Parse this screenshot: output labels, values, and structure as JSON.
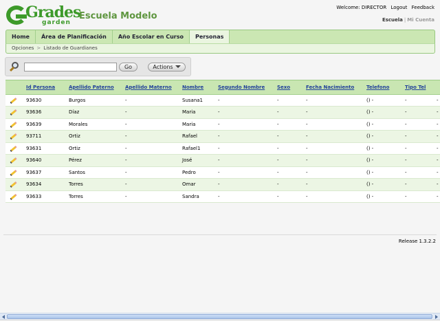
{
  "header": {
    "logo_text": "Grades",
    "logo_subtext": "garden",
    "school_name": "Escuela Modelo",
    "welcome": "Welcome: DIRECTOR",
    "logout": "Logout",
    "feedback": "Feedback",
    "context_active": "Escuela",
    "context_separator": "|",
    "context_inactive": "Mi Cuenta"
  },
  "nav": {
    "tabs": [
      {
        "label": "Home"
      },
      {
        "label": "Área de Planificación"
      },
      {
        "label": "Año Escolar en Curso"
      },
      {
        "label": "Personas"
      }
    ],
    "active_tab": "Personas"
  },
  "breadcrumb": {
    "root": "Opciones",
    "separator": ">",
    "current": "Listado de Guardianes"
  },
  "search": {
    "value": "",
    "go_label": "Go",
    "actions_label": "Actions"
  },
  "table": {
    "columns": [
      "Id Persona",
      "Apellido Paterno",
      "Apellido Materno",
      "Nombre",
      "Segundo Nombre",
      "Sexo",
      "Fecha Nacimiento",
      "Telefono",
      "Tipo Tel"
    ],
    "rows": [
      {
        "id": "93630",
        "ap_paterno": "Burgos",
        "ap_materno": "-",
        "nombre": "Susana1",
        "segundo": "-",
        "sexo": "-",
        "fecha": "-",
        "telefono": "() -",
        "tipo": "-",
        "extra": "-"
      },
      {
        "id": "93636",
        "ap_paterno": "Díaz",
        "ap_materno": "-",
        "nombre": "Maria",
        "segundo": "-",
        "sexo": "-",
        "fecha": "-",
        "telefono": "() -",
        "tipo": "-",
        "extra": "-"
      },
      {
        "id": "93639",
        "ap_paterno": "Morales",
        "ap_materno": "-",
        "nombre": "Maria",
        "segundo": "-",
        "sexo": "-",
        "fecha": "-",
        "telefono": "() -",
        "tipo": "-",
        "extra": "-"
      },
      {
        "id": "93711",
        "ap_paterno": "Ortiz",
        "ap_materno": "-",
        "nombre": "Rafael",
        "segundo": "-",
        "sexo": "-",
        "fecha": "-",
        "telefono": "() -",
        "tipo": "-",
        "extra": "-"
      },
      {
        "id": "93631",
        "ap_paterno": "Ortiz",
        "ap_materno": "-",
        "nombre": "Rafael1",
        "segundo": "-",
        "sexo": "-",
        "fecha": "-",
        "telefono": "() -",
        "tipo": "-",
        "extra": "-"
      },
      {
        "id": "93640",
        "ap_paterno": "Pérez",
        "ap_materno": "-",
        "nombre": "José",
        "segundo": "-",
        "sexo": "-",
        "fecha": "-",
        "telefono": "() -",
        "tipo": "-",
        "extra": "-"
      },
      {
        "id": "93637",
        "ap_paterno": "Santos",
        "ap_materno": "-",
        "nombre": "Pedro",
        "segundo": "-",
        "sexo": "-",
        "fecha": "-",
        "telefono": "() -",
        "tipo": "-",
        "extra": "-"
      },
      {
        "id": "93634",
        "ap_paterno": "Torres",
        "ap_materno": "-",
        "nombre": "Omar",
        "segundo": "-",
        "sexo": "-",
        "fecha": "-",
        "telefono": "() -",
        "tipo": "-",
        "extra": "-"
      },
      {
        "id": "93633",
        "ap_paterno": "Torres",
        "ap_materno": "-",
        "nombre": "Sandra",
        "segundo": "-",
        "sexo": "-",
        "fecha": "-",
        "telefono": "() -",
        "tipo": "-",
        "extra": "-"
      }
    ]
  },
  "footer": {
    "release": "Release 1.3.2.2"
  },
  "icons": {
    "edit": "pencil-icon",
    "search": "magnifier-icon",
    "dropdown": "chevron-down-icon"
  },
  "colors": {
    "brand_green": "#3d9a2a",
    "nav_bg": "#cbe7b3",
    "header_link": "#22429a",
    "row_alt": "#ecf6e4"
  }
}
